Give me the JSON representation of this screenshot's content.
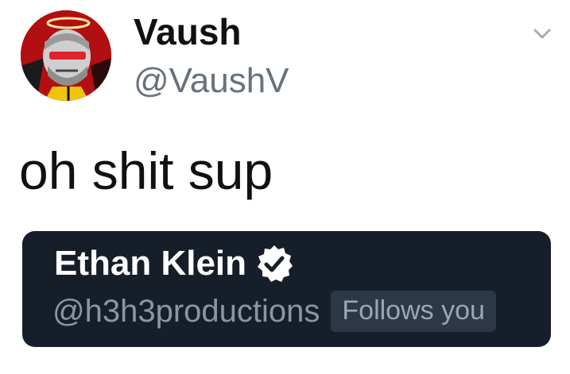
{
  "tweet": {
    "author": {
      "display_name": "Vaush",
      "handle": "@VaushV",
      "avatar_icon": "avatar-image"
    },
    "menu_icon": "chevron-down-icon",
    "text": "oh shit sup",
    "quoted_profile": {
      "display_name": "Ethan Klein",
      "handle": "@h3h3productions",
      "verified_icon": "verified-icon",
      "follows_badge": "Follows you"
    }
  },
  "colors": {
    "name_text": "#111111",
    "handle_text": "#67727c",
    "card_background": "#161e29",
    "badge_background": "#2c3846",
    "avatar_red": "#b10f12"
  }
}
